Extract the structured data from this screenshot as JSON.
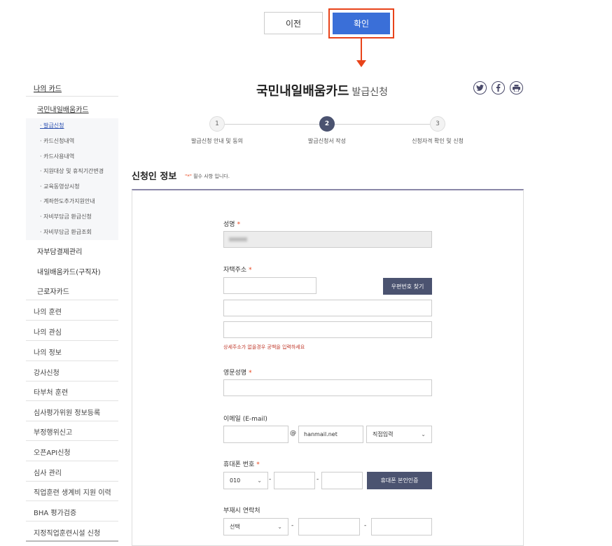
{
  "top_buttons": {
    "prev": "이전",
    "confirm": "확인"
  },
  "sidebar": {
    "title": "나의 카드",
    "card_menu": "국민내일배움카드",
    "sub_items": [
      {
        "label": "· 발급신청",
        "active": true
      },
      {
        "label": "· 카드신청내역"
      },
      {
        "label": "· 카드사용내역"
      },
      {
        "label": "· 지원대상 및 휴직기간변경"
      },
      {
        "label": "· 교육동영상시청"
      },
      {
        "label": "· 계좌한도추가지원안내"
      },
      {
        "label": "· 자비부담금 환급신청"
      },
      {
        "label": "· 자비부담금 환급조회"
      }
    ],
    "card_items": [
      "자부담결제관리",
      "내일배움카드(구직자)",
      "근로자카드"
    ],
    "menu_items": [
      "나의 훈련",
      "나의 관심",
      "나의 정보",
      "강사신청",
      "타부처 훈련",
      "심사평가위원 정보등록",
      "부정행위신고",
      "오픈API신청",
      "심사 관리",
      "직업훈련 생계비 지원 이력",
      "BHA 평가검증",
      "지정직업훈련시설 신청"
    ]
  },
  "page": {
    "title": "국민내일배움카드",
    "subtitle": "발급신청"
  },
  "sns_icons": [
    "twitter-icon",
    "facebook-icon",
    "print-icon"
  ],
  "steps": [
    {
      "num": "1",
      "label": "발급신청 안내 및 동의"
    },
    {
      "num": "2",
      "label": "발급신청서 작성",
      "active": true
    },
    {
      "num": "3",
      "label": "신청자격 확인 및 신청"
    }
  ],
  "section": {
    "title": "신청인 정보",
    "note_star": "\"*\"",
    "note_text": " 필수 사항 입니다."
  },
  "form": {
    "name_label": "성명",
    "address_label": "자택주소",
    "zip_button": "우편번호 찾기",
    "address_hint": "상세주소가 없을경우 공백을 입력하세요",
    "eng_name_label": "영문성명",
    "email_label": "이메일 (E-mail)",
    "email_at": "@",
    "email_domain": "hanmail.net",
    "email_select": "직접입력",
    "phone_label": "휴대폰 번호",
    "phone_prefix": "010",
    "phone_verify_button": "휴대폰 본인인증",
    "alt_contact_label": "부재시 연락처",
    "alt_select": "선택",
    "required_mark": "*",
    "dash": "-"
  },
  "colors": {
    "accent_red": "#e8431a",
    "primary_blue": "#3a6fd8",
    "dark_button": "#4b5370"
  }
}
